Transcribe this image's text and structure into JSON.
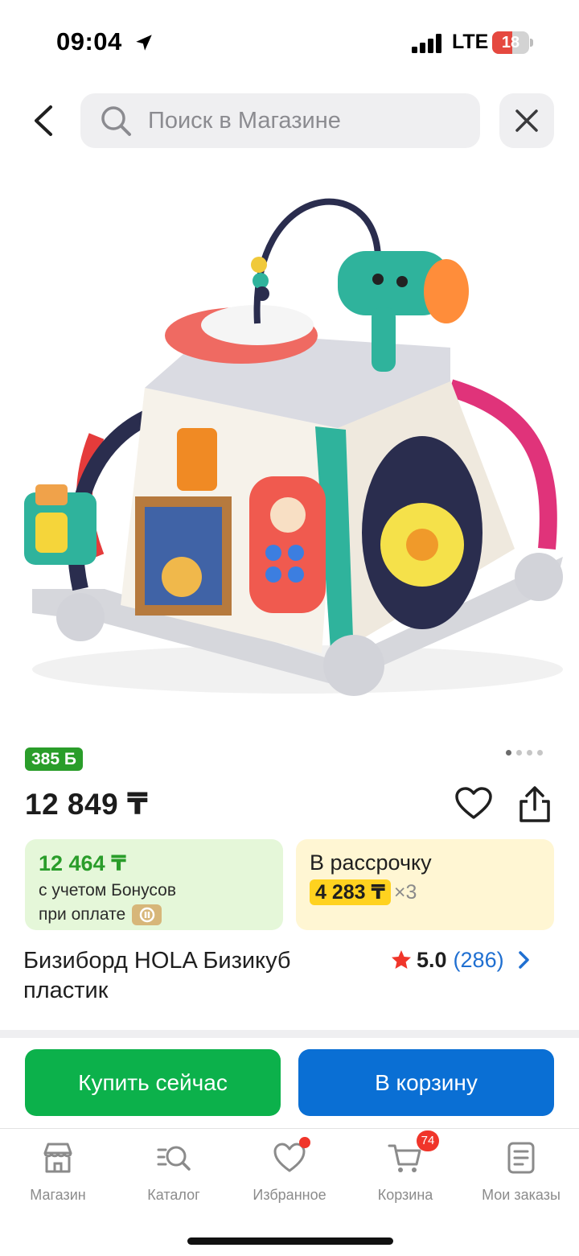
{
  "status_bar": {
    "time": "09:04",
    "network": "LTE",
    "battery": "18",
    "battery_level": 0.18
  },
  "header": {
    "search_placeholder": "Поиск в Магазине",
    "icons": [
      "chevron-left-icon",
      "search-icon",
      "close-icon"
    ]
  },
  "product": {
    "bonus_badge": "385 Б",
    "carousel_total": 4,
    "carousel_active": 1,
    "price": "12 849 ₸",
    "bonus_price": "12 464 ₸",
    "bonus_note_1": "с учетом Бонусов",
    "bonus_note_2": "при оплате",
    "installment_label": "В рассрочку",
    "installment_amount": "4 283 ₸",
    "installment_multiplier": "×3",
    "title": "Бизиборд HOLA Бизикуб пластик",
    "rating": "5.0",
    "reviews": "(286)"
  },
  "actions": {
    "buy_now": "Купить сейчас",
    "add_to_cart": "В корзину"
  },
  "bottom_nav": {
    "items": [
      {
        "label": "Магазин",
        "icon": "store-icon"
      },
      {
        "label": "Каталог",
        "icon": "catalog-search-icon"
      },
      {
        "label": "Избранное",
        "icon": "heart-icon"
      },
      {
        "label": "Корзина",
        "icon": "cart-icon",
        "badge": "74"
      },
      {
        "label": "Мои заказы",
        "icon": "orders-icon"
      }
    ]
  },
  "colors": {
    "green": "#0cb14b",
    "blue": "#0a6fd4",
    "bonus_green": "#2a9d2a",
    "badge_red": "#f0352a",
    "installment_yellow": "#ffd21f"
  }
}
